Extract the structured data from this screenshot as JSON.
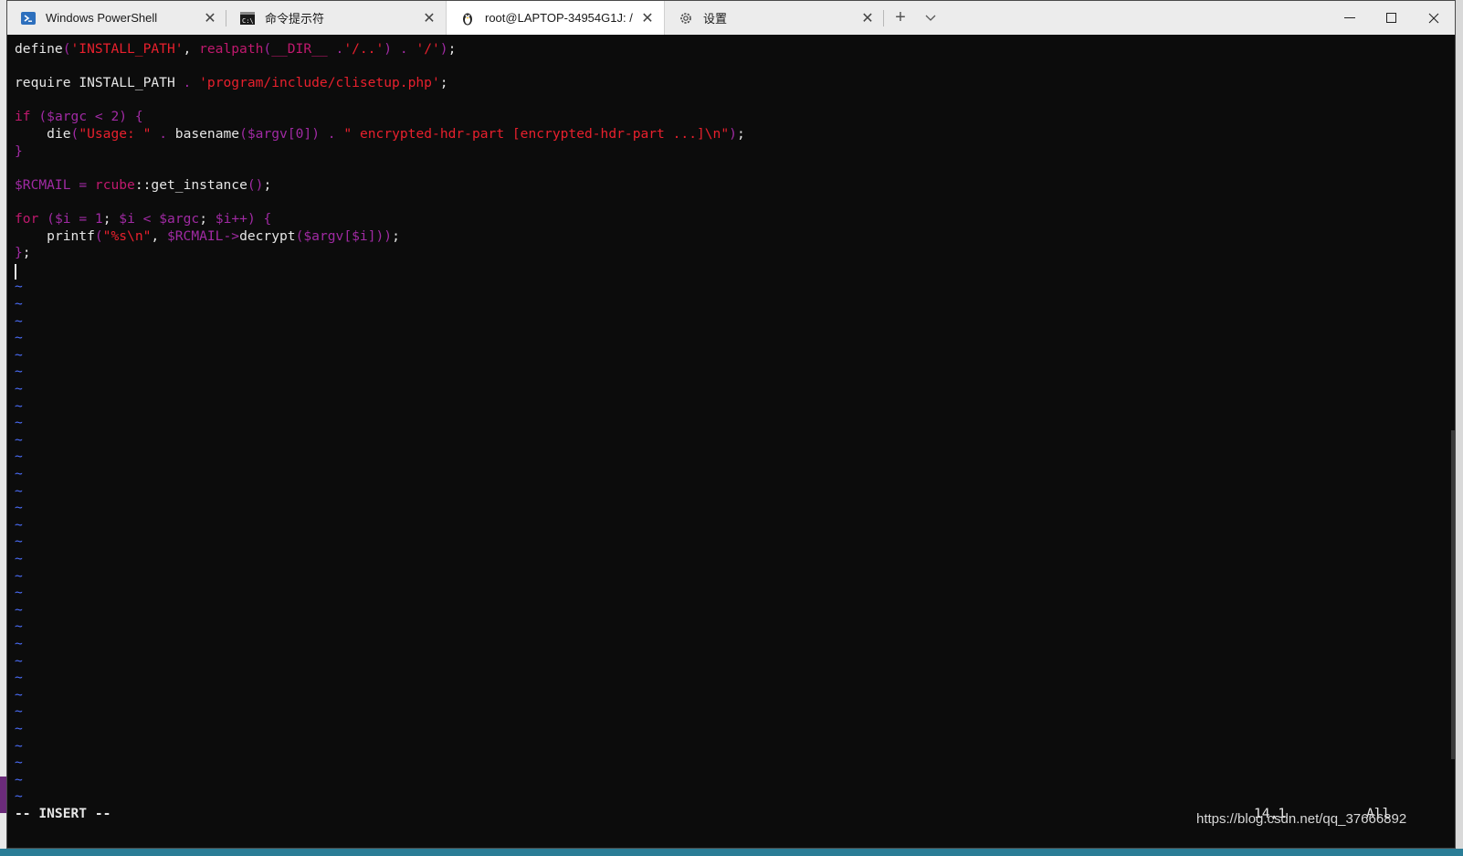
{
  "tabs": [
    {
      "label": "Windows PowerShell",
      "icon": "powershell-icon",
      "close": "✕"
    },
    {
      "label": "命令提示符",
      "icon": "cmd-icon",
      "close": "✕"
    },
    {
      "label": "root@LAPTOP-34954G1J: /",
      "icon": "linux-penguin-icon",
      "close": "✕"
    },
    {
      "label": "设置",
      "icon": "gear-icon",
      "close": "✕"
    }
  ],
  "tabbar": {
    "new_tab": "+",
    "dropdown": "⌄"
  },
  "window_controls": {
    "minimize": "—",
    "maximize": "☐",
    "close": "✕"
  },
  "editor": {
    "lines": [
      "define('INSTALL_PATH', realpath(__DIR__ .'/..') . '/');",
      "",
      "require INSTALL_PATH . 'program/include/clisetup.php';",
      "",
      "if ($argc < 2) {",
      "    die(\"Usage: \" . basename($argv[0]) . \" encrypted-hdr-part [encrypted-hdr-part ...]\\n\");",
      "}",
      "",
      "$RCMAIL = rcube::get_instance();",
      "",
      "for ($i = 1; $i < $argc; $i++) {",
      "    printf(\"%s\\n\", $RCMAIL->decrypt($argv[$i]));",
      "};"
    ],
    "tilde": "~",
    "tilde_count": 31,
    "mode": "-- INSERT --",
    "cursor_pos": "14,1",
    "scroll_pos": "All"
  },
  "watermark": "https://blog.csdn.net/qq_37666892",
  "colors": {
    "keyword": "#c0196e",
    "string": "#e8202d",
    "variable": "#a02aa3",
    "tilde": "#4a6cf7",
    "background": "#0c0c0c"
  }
}
